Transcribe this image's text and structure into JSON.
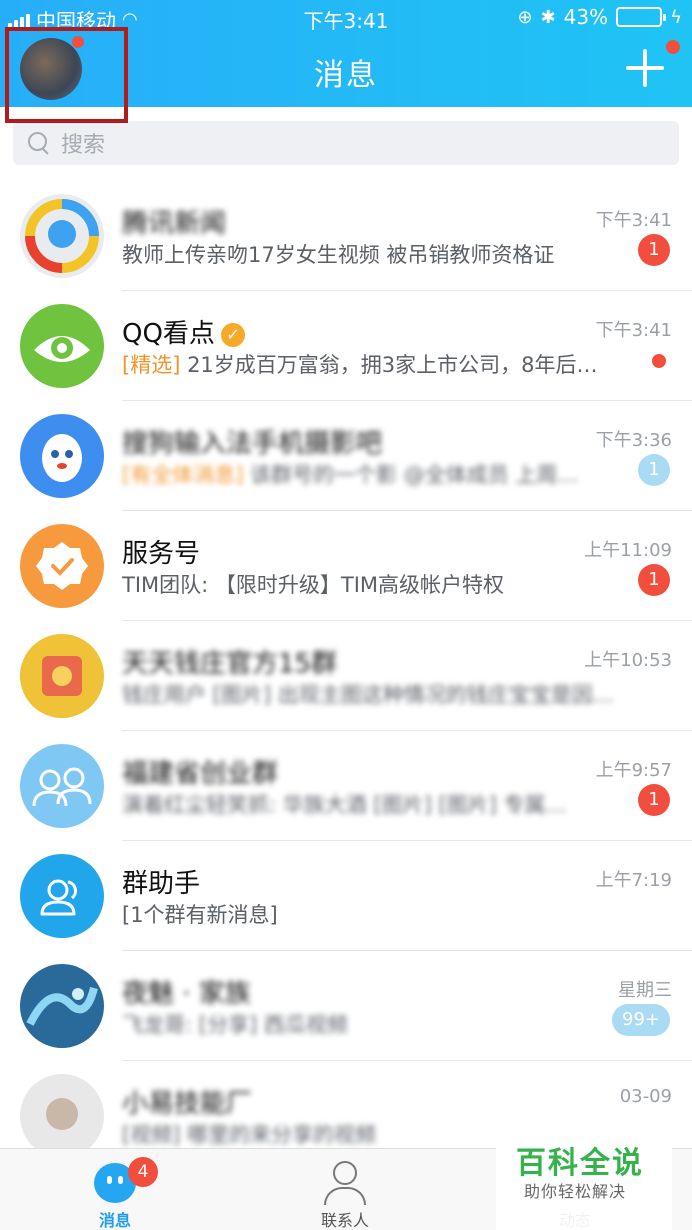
{
  "statusbar": {
    "carrier": "中国移动",
    "time": "下午3:41",
    "battery_percent": "43%",
    "battery_level": 0.43,
    "colors": {
      "battery_fill": "#4cd964"
    }
  },
  "header": {
    "title": "消息",
    "plus_icon": "plus-icon",
    "accent_color": "#27aef8"
  },
  "search": {
    "placeholder": "搜索"
  },
  "conversations": [
    {
      "name": "腾讯新闻",
      "message": "教师上传亲吻17岁女生视频 被吊销教师资格证",
      "time": "下午3:41",
      "badge": "1"
    },
    {
      "name": "QQ看点",
      "tag": "[精选]",
      "message": " 21岁成百万富翁，拥3家上市公司，8年后…",
      "time": "下午3:41",
      "verified_icon": "verified-icon"
    },
    {
      "name": "搜狗输入法手机摄影吧",
      "tag": "[有全体消息]",
      "message": " 该群号的一个影 @全体成员 上周…",
      "time": "下午3:36",
      "badge": "1"
    },
    {
      "name": "服务号",
      "message": "TIM团队: 【限时升级】TIM高级帐户特权",
      "time": "上午11:09",
      "badge": "1"
    },
    {
      "name": "天天钱庄官方15群",
      "message": "钱庄用户 [图片] 出现主图这种情况的钱庄宝宝是因为…",
      "time": "上午10:53"
    },
    {
      "name": "福建省创业群",
      "message": "演着红尘轻笑抓: 华族大酒 [图片] [图片] 专属…",
      "time": "上午9:57",
      "badge": "1"
    },
    {
      "name": "群助手",
      "tag": "[1个群有新消息]",
      "time": "上午7:19"
    },
    {
      "name": "夜魅 · 家族",
      "message": "飞龙哥: [分享] 西瓜视频",
      "time": "星期三",
      "badge": "99+"
    },
    {
      "name": "小易技能厂",
      "message": "[视频] 哪里的来分享的视频",
      "time": "03-09"
    }
  ],
  "tabbar": {
    "messages_label": "消息",
    "messages_badge": "4",
    "contacts_label": "联系人",
    "dynamic_label": "动态"
  },
  "watermark": {
    "title": "百科全说",
    "subtitle": "助你轻松解决"
  }
}
